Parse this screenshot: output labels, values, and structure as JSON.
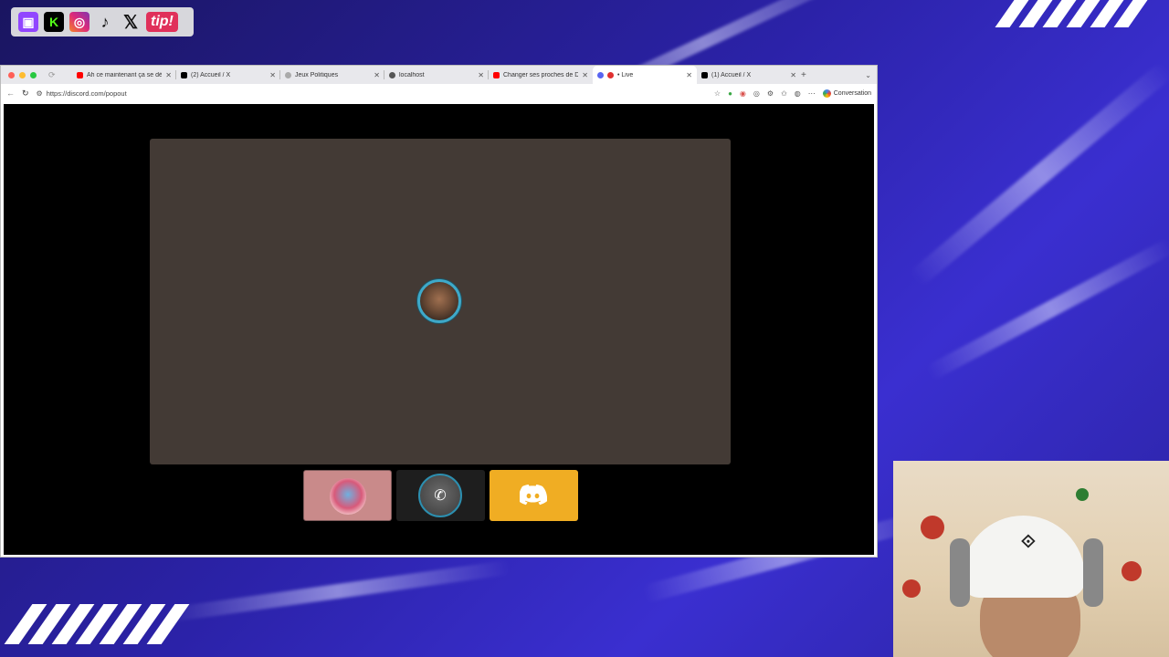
{
  "overlay": {
    "social_icons": [
      {
        "name": "twitch",
        "glyph": "▣"
      },
      {
        "name": "kick",
        "glyph": "K"
      },
      {
        "name": "instagram",
        "glyph": "◎"
      },
      {
        "name": "tiktok",
        "glyph": "♪"
      },
      {
        "name": "x",
        "glyph": "𝕏"
      },
      {
        "name": "tip",
        "label": "tip!"
      }
    ]
  },
  "browser": {
    "tabs": [
      {
        "title": "Ah ce maintenant ça se dégui",
        "favicon_color": "#ff0000",
        "active": false
      },
      {
        "title": "(2) Accueil / X",
        "favicon_color": "#000000",
        "active": false
      },
      {
        "title": "Jeux Politiques",
        "favicon_color": "#aaaaaa",
        "active": false
      },
      {
        "title": "localhost",
        "favicon_color": "#555555",
        "active": false
      },
      {
        "title": "Changer ses proches de DRO",
        "favicon_color": "#ff0000",
        "active": false
      },
      {
        "title": "• Live",
        "favicon_color": "#5865f2",
        "active": true
      },
      {
        "title": "(1) Accueil / X",
        "favicon_color": "#000000",
        "active": false
      }
    ],
    "new_tab_glyph": "+",
    "url": "https://discord.com/popout",
    "conversation_label": "Conversation"
  },
  "call": {
    "tiles": [
      {
        "kind": "avatar-tile",
        "label": "participant-1"
      },
      {
        "kind": "phone-tile",
        "glyph": "✆"
      },
      {
        "kind": "discord-tile"
      }
    ]
  },
  "colors": {
    "stage_bg": "#433a35",
    "speaking_ring": "#3ea9c9",
    "discord_tile": "#f0ad23"
  }
}
